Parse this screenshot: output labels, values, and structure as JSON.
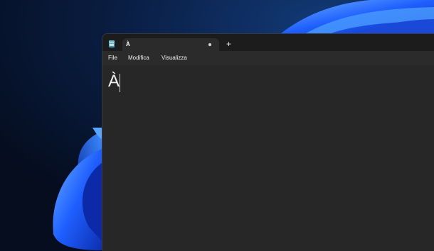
{
  "window": {
    "tab_title": "À",
    "new_tab_label": "+",
    "menu": [
      "File",
      "Modifica",
      "Visualizza"
    ]
  },
  "document": {
    "content": "À"
  },
  "icons": [
    "notepad-icon",
    "unsaved-dot-icon",
    "plus-icon"
  ],
  "colors": {
    "desktop_bg": "#061229",
    "window_bg": "#272727",
    "titlebar_bg": "#1c1c1c",
    "bloom_blue": "#1f5fff"
  }
}
